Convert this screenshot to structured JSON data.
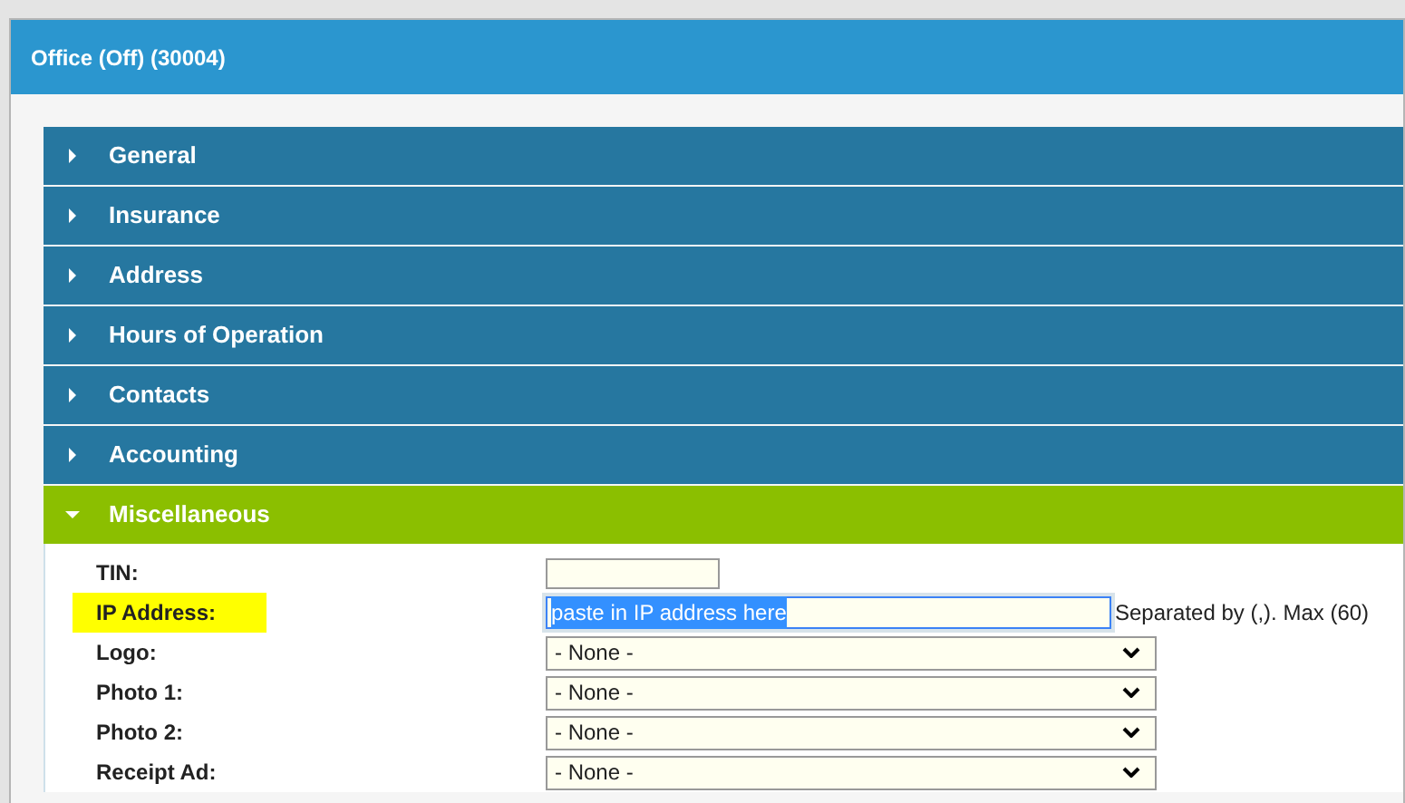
{
  "window": {
    "title": "Office (Off) (30004)"
  },
  "sections": [
    {
      "label": "General",
      "expanded": false
    },
    {
      "label": "Insurance",
      "expanded": false
    },
    {
      "label": "Address",
      "expanded": false
    },
    {
      "label": "Hours of Operation",
      "expanded": false
    },
    {
      "label": "Contacts",
      "expanded": false
    },
    {
      "label": "Accounting",
      "expanded": false
    },
    {
      "label": "Miscellaneous",
      "expanded": true
    }
  ],
  "fields": [
    {
      "label": "TIN:",
      "kind": "text",
      "highlighted": false
    },
    {
      "label": "IP Address:",
      "kind": "text",
      "highlighted": true,
      "value": "paste in IP address here",
      "text_selected": true,
      "hint": "Separated by (,). Max (60)"
    },
    {
      "label": "Logo:",
      "kind": "select",
      "highlighted": false,
      "value": "- None -"
    },
    {
      "label": "Photo 1:",
      "kind": "select",
      "highlighted": false,
      "value": "- None -"
    },
    {
      "label": "Photo 2:",
      "kind": "select",
      "highlighted": false,
      "value": "- None -"
    },
    {
      "label": "Receipt Ad:",
      "kind": "select",
      "highlighted": false,
      "value": "- None -"
    }
  ]
}
